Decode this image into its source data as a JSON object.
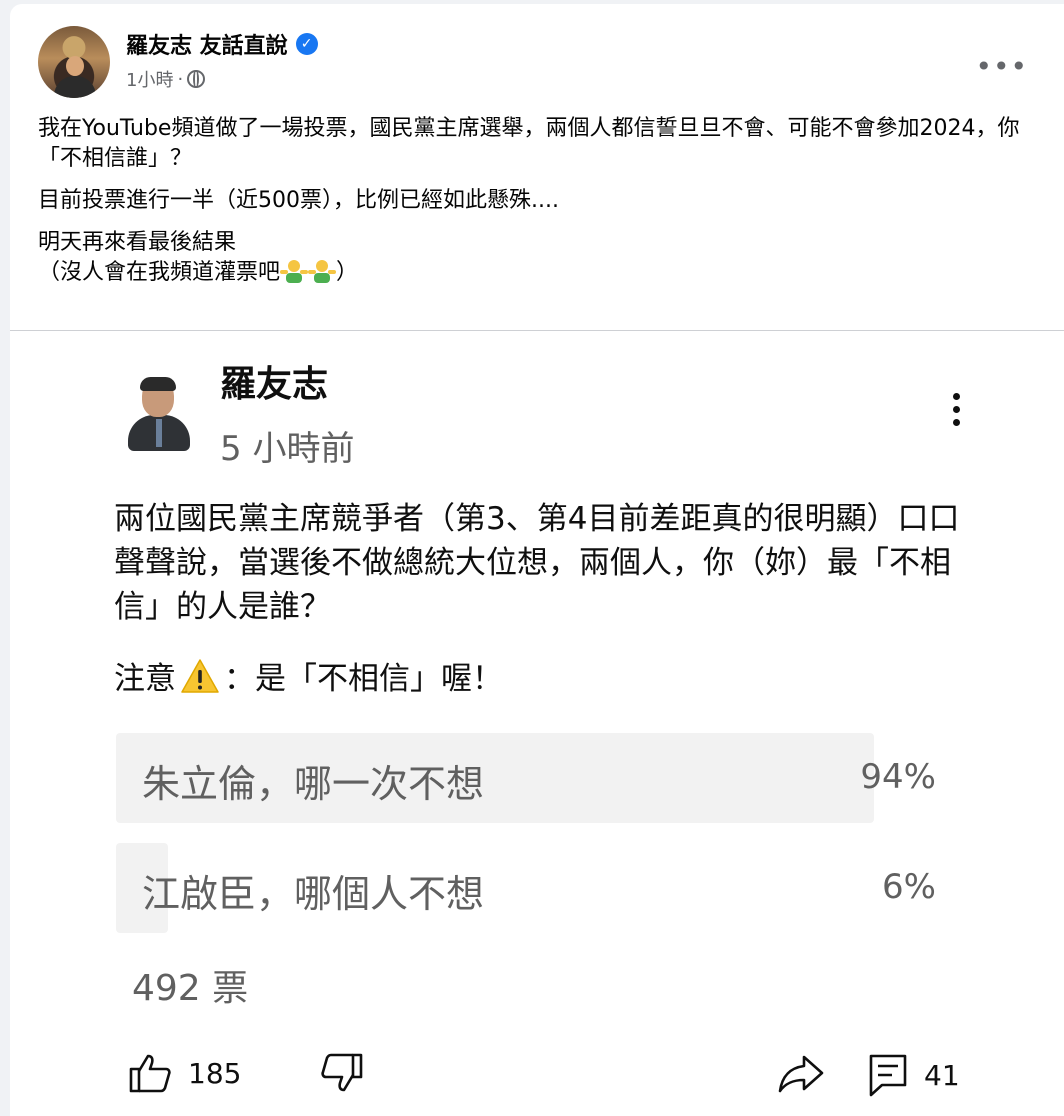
{
  "post": {
    "author": "羅友志 友話直說",
    "time": "1小時",
    "separator": "·",
    "paragraphs": [
      "我在YouTube頻道做了一場投票，國民黨主席選舉，兩個人都信誓旦旦不會、可能不會參加2024，你「不相信誰」？",
      "目前投票進行一半（近500票），比例已經如此懸殊....",
      "明天再來看最後結果",
      "（沒人會在我頻道灌票吧",
      "）"
    ]
  },
  "youtube_post": {
    "channel_name": "羅友志",
    "time": "5 小時前",
    "body": "兩位國民黨主席競爭者（第3、第4目前差距真的很明顯）口口聲聲說，當選後不做總統大位想，兩個人，你（妳）最「不相信」的人是誰？",
    "note_prefix": "注意",
    "note_suffix": "：是「不相信」喔！",
    "poll": {
      "options": [
        {
          "label": "朱立倫，哪一次不想",
          "percent_text": "94%",
          "fraction": 0.94
        },
        {
          "label": "江啟臣，哪個人不想",
          "percent_text": "6%",
          "fraction": 0.06
        }
      ],
      "votes": "492 票"
    },
    "actions": {
      "likes": "185",
      "comments": "41"
    }
  },
  "colors": {
    "verified": "#1877f2",
    "poll_fill": "#f2f2f2",
    "secondary_text": "#606060"
  },
  "icons": [
    "verified-badge-icon",
    "globe-icon",
    "more-options-icon",
    "kebab-menu-icon",
    "warning-icon",
    "thumbs-up-icon",
    "thumbs-down-icon",
    "share-icon",
    "comment-icon",
    "person-shrugging-emoji"
  ]
}
